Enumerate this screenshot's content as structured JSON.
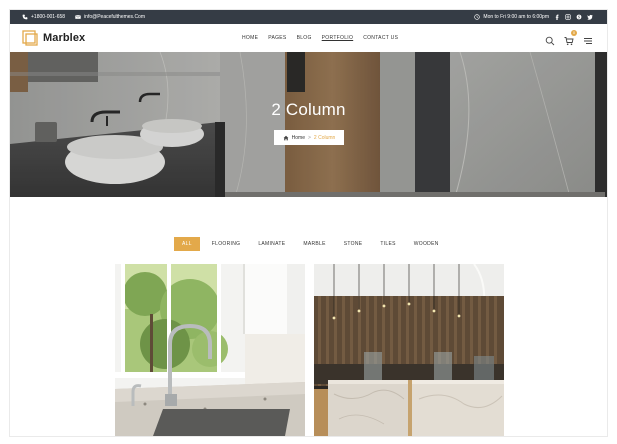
{
  "topbar": {
    "phone": "+1800-001-658",
    "email": "info@Peacefulthemes.Com",
    "hours": "Mon to Fri 9:00 am to 6:00pm",
    "social_icons": [
      "facebook-icon",
      "instagram-icon",
      "skype-icon",
      "twitter-icon"
    ]
  },
  "header": {
    "logo_text": "Marblex",
    "nav": [
      {
        "label": "HOME"
      },
      {
        "label": "PAGES"
      },
      {
        "label": "BLOG"
      },
      {
        "label": "PORTFOLIO",
        "active": true
      },
      {
        "label": "CONTACT US"
      }
    ],
    "icons": [
      "search-icon",
      "cart-icon",
      "menu-icon"
    ],
    "cart_count": "0"
  },
  "hero": {
    "title": "2 Column",
    "breadcrumb": {
      "home": "Home",
      "separator": ">",
      "current": "2 Column"
    }
  },
  "filters": {
    "items": [
      "ALL",
      "FLOORING",
      "LAMINATE",
      "MARBLE",
      "STONE",
      "TILES",
      "WOODEN"
    ],
    "active": "ALL"
  },
  "colors": {
    "accent": "#e3a94a",
    "topbar_bg": "#353c45"
  }
}
